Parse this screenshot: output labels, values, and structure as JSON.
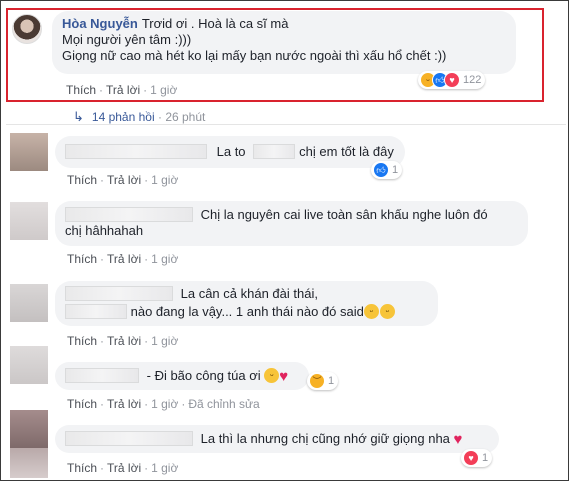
{
  "main_comment": {
    "author": "Hòa Nguyễn",
    "line1": "Trơid ơi . Hoà là ca sĩ mà",
    "line2": "Mọi người yên tâm :)))",
    "line3": "Giọng nữ cao mà hét ko lại mấy bạn nước ngoài thì xấu hổ chết :))",
    "like": "Thích",
    "reply": "Trả lời",
    "time": "1 giờ",
    "reactions": [
      "haha-icon",
      "like-icon",
      "love-icon"
    ],
    "reaction_count": "122"
  },
  "replies_link": {
    "label": "14 phản hồi",
    "time": "26 phút"
  },
  "replies": [
    {
      "text_a": "La to",
      "text_b": "chị em tốt là đây",
      "like": "Thích",
      "reply": "Trả lời",
      "time": "1 giờ",
      "reaction_count": "1",
      "reaction_icon": "like-icon"
    },
    {
      "line1": "Chị la nguyên cai live toàn sân khấu nghe luôn đó",
      "line2": "chị hâhhahah",
      "like": "Thích",
      "reply": "Trả lời",
      "time": "1 giờ"
    },
    {
      "line1": "La cân cả khán đài thái,",
      "line2": "nào đang la vậy... 1 anh thái nào đó said",
      "like": "Thích",
      "reply": "Trả lời",
      "time": "1 giờ"
    },
    {
      "text": "- Đi bão công túa ơi",
      "like": "Thích",
      "reply": "Trả lời",
      "time": "1 giờ",
      "edited": "Đã chỉnh sửa",
      "reaction_count": "1",
      "reaction_icon": "sad-icon"
    },
    {
      "text": "La thì la nhưng chị cũng nhớ giữ giọng nha",
      "like": "Thích",
      "reply": "Trả lời",
      "time": "1 giờ",
      "reaction_count": "1",
      "reaction_icon": "love-icon"
    }
  ],
  "colors": {
    "highlight_border": "#d9232e",
    "name_link": "#385898",
    "bubble_bg": "#f2f3f5",
    "meta_grey": "#90949c"
  }
}
